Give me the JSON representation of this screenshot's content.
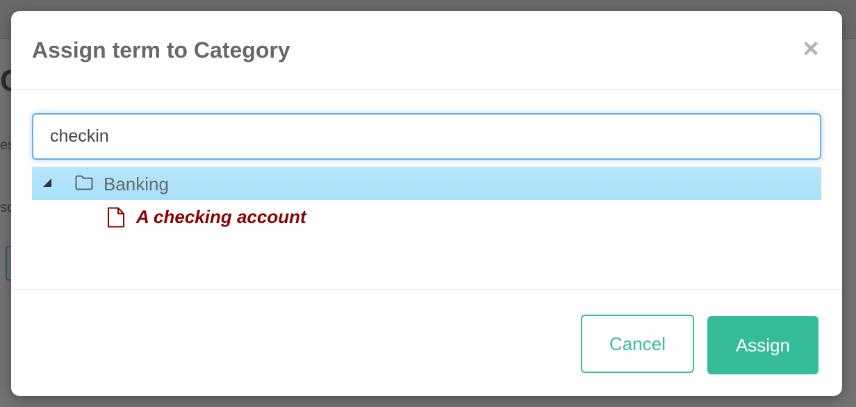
{
  "modal": {
    "title": "Assign term to Category",
    "close_symbol": "×"
  },
  "search": {
    "value": "checkin",
    "placeholder": ""
  },
  "tree": {
    "category": {
      "label": "Banking",
      "icon": "folder-icon",
      "expanded": true
    },
    "terms": [
      {
        "label": "A checking account",
        "icon": "file-icon"
      }
    ]
  },
  "footer": {
    "cancel_label": "Cancel",
    "assign_label": "Assign"
  },
  "colors": {
    "accent": "#37bc9b",
    "selected_row": "#b3e5fc",
    "term_text": "#8b0000",
    "input_focus": "#66afe9"
  }
}
